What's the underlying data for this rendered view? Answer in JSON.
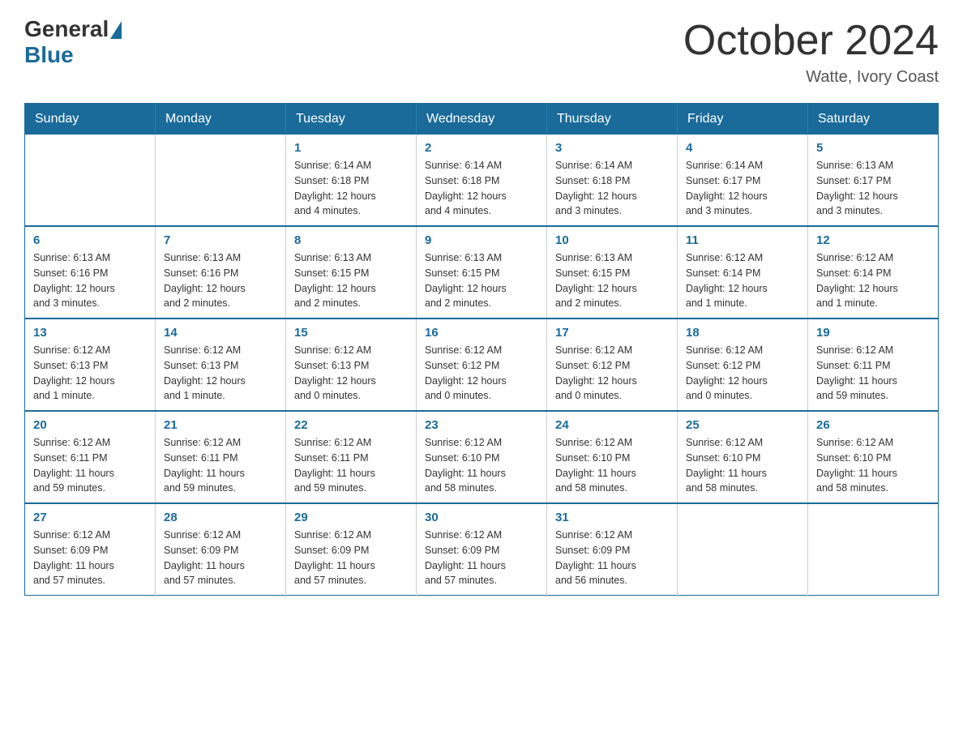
{
  "logo": {
    "general": "General",
    "blue": "Blue"
  },
  "title": "October 2024",
  "subtitle": "Watte, Ivory Coast",
  "headers": [
    "Sunday",
    "Monday",
    "Tuesday",
    "Wednesday",
    "Thursday",
    "Friday",
    "Saturday"
  ],
  "weeks": [
    [
      {
        "day": "",
        "info": ""
      },
      {
        "day": "",
        "info": ""
      },
      {
        "day": "1",
        "info": "Sunrise: 6:14 AM\nSunset: 6:18 PM\nDaylight: 12 hours\nand 4 minutes."
      },
      {
        "day": "2",
        "info": "Sunrise: 6:14 AM\nSunset: 6:18 PM\nDaylight: 12 hours\nand 4 minutes."
      },
      {
        "day": "3",
        "info": "Sunrise: 6:14 AM\nSunset: 6:18 PM\nDaylight: 12 hours\nand 3 minutes."
      },
      {
        "day": "4",
        "info": "Sunrise: 6:14 AM\nSunset: 6:17 PM\nDaylight: 12 hours\nand 3 minutes."
      },
      {
        "day": "5",
        "info": "Sunrise: 6:13 AM\nSunset: 6:17 PM\nDaylight: 12 hours\nand 3 minutes."
      }
    ],
    [
      {
        "day": "6",
        "info": "Sunrise: 6:13 AM\nSunset: 6:16 PM\nDaylight: 12 hours\nand 3 minutes."
      },
      {
        "day": "7",
        "info": "Sunrise: 6:13 AM\nSunset: 6:16 PM\nDaylight: 12 hours\nand 2 minutes."
      },
      {
        "day": "8",
        "info": "Sunrise: 6:13 AM\nSunset: 6:15 PM\nDaylight: 12 hours\nand 2 minutes."
      },
      {
        "day": "9",
        "info": "Sunrise: 6:13 AM\nSunset: 6:15 PM\nDaylight: 12 hours\nand 2 minutes."
      },
      {
        "day": "10",
        "info": "Sunrise: 6:13 AM\nSunset: 6:15 PM\nDaylight: 12 hours\nand 2 minutes."
      },
      {
        "day": "11",
        "info": "Sunrise: 6:12 AM\nSunset: 6:14 PM\nDaylight: 12 hours\nand 1 minute."
      },
      {
        "day": "12",
        "info": "Sunrise: 6:12 AM\nSunset: 6:14 PM\nDaylight: 12 hours\nand 1 minute."
      }
    ],
    [
      {
        "day": "13",
        "info": "Sunrise: 6:12 AM\nSunset: 6:13 PM\nDaylight: 12 hours\nand 1 minute."
      },
      {
        "day": "14",
        "info": "Sunrise: 6:12 AM\nSunset: 6:13 PM\nDaylight: 12 hours\nand 1 minute."
      },
      {
        "day": "15",
        "info": "Sunrise: 6:12 AM\nSunset: 6:13 PM\nDaylight: 12 hours\nand 0 minutes."
      },
      {
        "day": "16",
        "info": "Sunrise: 6:12 AM\nSunset: 6:12 PM\nDaylight: 12 hours\nand 0 minutes."
      },
      {
        "day": "17",
        "info": "Sunrise: 6:12 AM\nSunset: 6:12 PM\nDaylight: 12 hours\nand 0 minutes."
      },
      {
        "day": "18",
        "info": "Sunrise: 6:12 AM\nSunset: 6:12 PM\nDaylight: 12 hours\nand 0 minutes."
      },
      {
        "day": "19",
        "info": "Sunrise: 6:12 AM\nSunset: 6:11 PM\nDaylight: 11 hours\nand 59 minutes."
      }
    ],
    [
      {
        "day": "20",
        "info": "Sunrise: 6:12 AM\nSunset: 6:11 PM\nDaylight: 11 hours\nand 59 minutes."
      },
      {
        "day": "21",
        "info": "Sunrise: 6:12 AM\nSunset: 6:11 PM\nDaylight: 11 hours\nand 59 minutes."
      },
      {
        "day": "22",
        "info": "Sunrise: 6:12 AM\nSunset: 6:11 PM\nDaylight: 11 hours\nand 59 minutes."
      },
      {
        "day": "23",
        "info": "Sunrise: 6:12 AM\nSunset: 6:10 PM\nDaylight: 11 hours\nand 58 minutes."
      },
      {
        "day": "24",
        "info": "Sunrise: 6:12 AM\nSunset: 6:10 PM\nDaylight: 11 hours\nand 58 minutes."
      },
      {
        "day": "25",
        "info": "Sunrise: 6:12 AM\nSunset: 6:10 PM\nDaylight: 11 hours\nand 58 minutes."
      },
      {
        "day": "26",
        "info": "Sunrise: 6:12 AM\nSunset: 6:10 PM\nDaylight: 11 hours\nand 58 minutes."
      }
    ],
    [
      {
        "day": "27",
        "info": "Sunrise: 6:12 AM\nSunset: 6:09 PM\nDaylight: 11 hours\nand 57 minutes."
      },
      {
        "day": "28",
        "info": "Sunrise: 6:12 AM\nSunset: 6:09 PM\nDaylight: 11 hours\nand 57 minutes."
      },
      {
        "day": "29",
        "info": "Sunrise: 6:12 AM\nSunset: 6:09 PM\nDaylight: 11 hours\nand 57 minutes."
      },
      {
        "day": "30",
        "info": "Sunrise: 6:12 AM\nSunset: 6:09 PM\nDaylight: 11 hours\nand 57 minutes."
      },
      {
        "day": "31",
        "info": "Sunrise: 6:12 AM\nSunset: 6:09 PM\nDaylight: 11 hours\nand 56 minutes."
      },
      {
        "day": "",
        "info": ""
      },
      {
        "day": "",
        "info": ""
      }
    ]
  ]
}
